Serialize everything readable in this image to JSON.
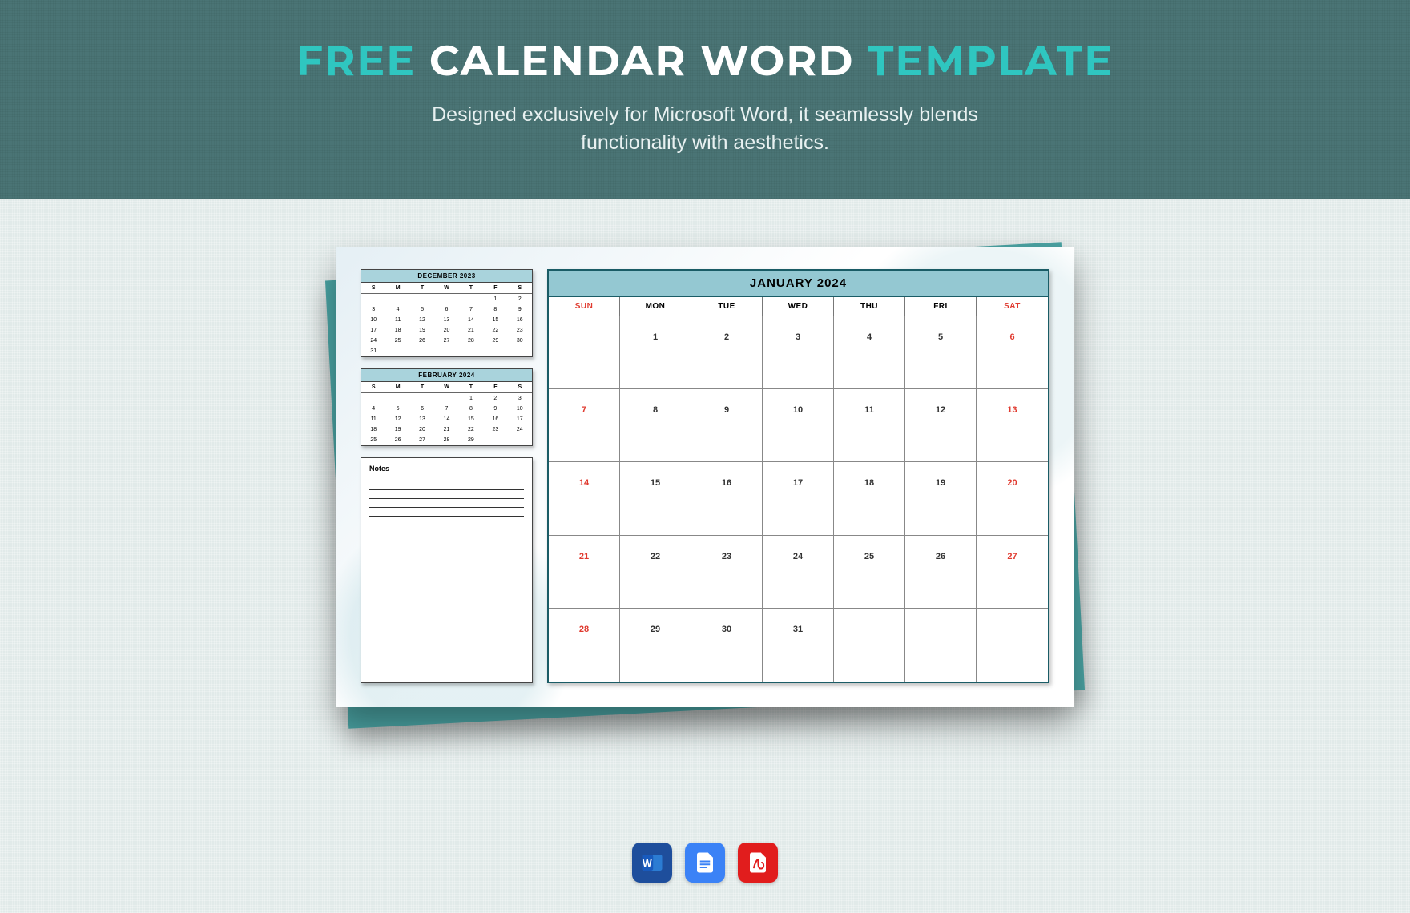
{
  "banner": {
    "word_free": "FREE",
    "word_middle": "CALENDAR WORD",
    "word_template": "TEMPLATE",
    "subtitle_l1": "Designed exclusively for Microsoft Word, it seamlessly blends",
    "subtitle_l2": "functionality with aesthetics."
  },
  "mini_days": [
    "S",
    "M",
    "T",
    "W",
    "T",
    "F",
    "S"
  ],
  "mini1": {
    "title": "DECEMBER 2023",
    "rows": [
      [
        "",
        "",
        "",
        "",
        "",
        "1",
        "2"
      ],
      [
        "3",
        "4",
        "5",
        "6",
        "7",
        "8",
        "9"
      ],
      [
        "10",
        "11",
        "12",
        "13",
        "14",
        "15",
        "16"
      ],
      [
        "17",
        "18",
        "19",
        "20",
        "21",
        "22",
        "23"
      ],
      [
        "24",
        "25",
        "26",
        "27",
        "28",
        "29",
        "30"
      ],
      [
        "31",
        "",
        "",
        "",
        "",
        "",
        ""
      ]
    ]
  },
  "mini2": {
    "title": "FEBRUARY 2024",
    "rows": [
      [
        "",
        "",
        "",
        "",
        "1",
        "2",
        "3"
      ],
      [
        "4",
        "5",
        "6",
        "7",
        "8",
        "9",
        "10"
      ],
      [
        "11",
        "12",
        "13",
        "14",
        "15",
        "16",
        "17"
      ],
      [
        "18",
        "19",
        "20",
        "21",
        "22",
        "23",
        "24"
      ],
      [
        "25",
        "26",
        "27",
        "28",
        "29",
        "",
        ""
      ]
    ]
  },
  "notes_label": "Notes",
  "main": {
    "title": "JANUARY 2024",
    "dow": [
      "SUN",
      "MON",
      "TUE",
      "WED",
      "THU",
      "FRI",
      "SAT"
    ],
    "cells": [
      "",
      "1",
      "2",
      "3",
      "4",
      "5",
      "6",
      "7",
      "8",
      "9",
      "10",
      "11",
      "12",
      "13",
      "14",
      "15",
      "16",
      "17",
      "18",
      "19",
      "20",
      "21",
      "22",
      "23",
      "24",
      "25",
      "26",
      "27",
      "28",
      "29",
      "30",
      "31",
      "",
      "",
      ""
    ]
  },
  "icons": {
    "word": "word-icon",
    "gdoc": "google-doc-icon",
    "pdf": "pdf-icon"
  },
  "colors": {
    "accent": "#2fc6c0",
    "banner_bg": "#4a7475",
    "weekend": "#e03a2f",
    "header_bg": "#94c8d2"
  }
}
